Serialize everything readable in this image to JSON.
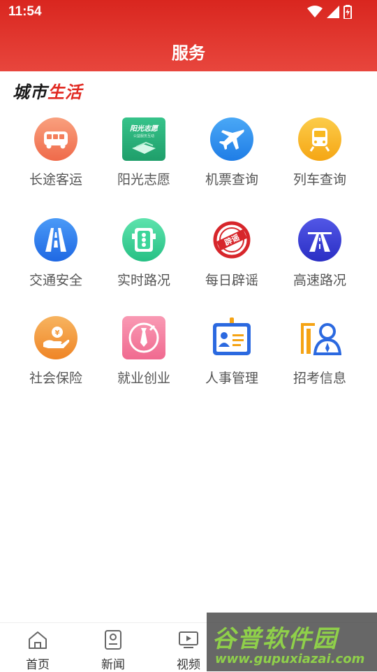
{
  "status_bar": {
    "time": "11:54"
  },
  "header": {
    "title": "服务"
  },
  "section": {
    "title_part1": "城市",
    "title_part2": "生活"
  },
  "services": [
    {
      "label": "长途客运",
      "icon": "bus-icon",
      "color": "#f47f5c"
    },
    {
      "label": "阳光志愿",
      "icon": "volunteer-icon",
      "color": "#2db37d",
      "icon_text": "阳光志愿",
      "icon_subtext": "公益服务互动"
    },
    {
      "label": "机票查询",
      "icon": "airplane-icon",
      "color": "#2a8ff0"
    },
    {
      "label": "列车查询",
      "icon": "train-icon",
      "color": "#f8b81f"
    },
    {
      "label": "交通安全",
      "icon": "road-icon",
      "color": "#2c7ef0"
    },
    {
      "label": "实时路况",
      "icon": "traffic-light-icon",
      "color": "#3cd59a"
    },
    {
      "label": "每日辟谣",
      "icon": "rumor-stamp-icon",
      "color": "#d7262b",
      "icon_text": "辟谣"
    },
    {
      "label": "高速路况",
      "icon": "highway-icon",
      "color": "#3a3fd6"
    },
    {
      "label": "社会保险",
      "icon": "insurance-icon",
      "color": "#f49a3c"
    },
    {
      "label": "就业创业",
      "icon": "tie-icon",
      "color": "#f47fa0"
    },
    {
      "label": "人事管理",
      "icon": "id-badge-icon",
      "color": "#2b69e0"
    },
    {
      "label": "招考信息",
      "icon": "exam-icon",
      "color": "#2b69e0"
    }
  ],
  "bottom_nav": [
    {
      "label": "首页",
      "icon": "home-icon"
    },
    {
      "label": "新闻",
      "icon": "news-icon"
    },
    {
      "label": "视频",
      "icon": "video-icon"
    }
  ],
  "watermark": {
    "title": "谷普软件园",
    "url": "www.gupuxiazai.com"
  }
}
